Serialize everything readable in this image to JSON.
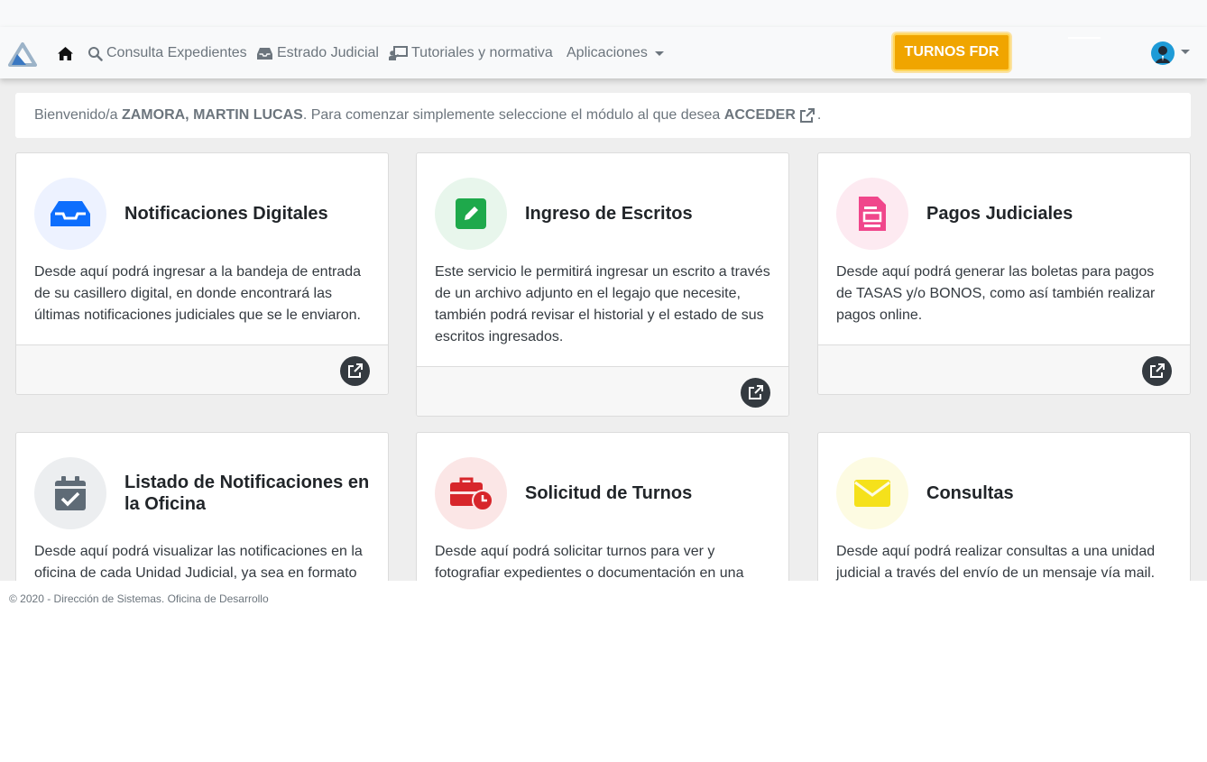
{
  "navbar": {
    "links": [
      "Consulta Expedientes",
      "Estrado Judicial",
      "Tutoriales y normativa",
      "Aplicaciones"
    ],
    "turnos_label": "TURNOS FDR"
  },
  "welcome": {
    "prefix": "Bienvenido/a",
    "user": "ZAMORA, MARTIN LUCAS",
    "middle": ". Para comenzar simplemente seleccione el módulo al que desea",
    "action": "ACCEDER",
    "end": "."
  },
  "cards": [
    {
      "title": "Notificaciones Digitales",
      "description": "Desde aquí podrá ingresar a la bandeja de entrada de su casillero digital, en donde encontrará las últimas notificaciones judiciales que se le enviaron.",
      "icon": "inbox-icon",
      "color": "#0d6efd",
      "bg": "#edf2ff"
    },
    {
      "title": "Ingreso de Escritos",
      "description": "Este servicio le permitirá ingresar un escrito a través de un archivo adjunto en el legajo que necesite, también podrá revisar el historial y el estado de sus escritos ingresados.",
      "icon": "edit-icon",
      "color": "#1ea94b",
      "bg": "#e8f6ec"
    },
    {
      "title": "Pagos Judiciales",
      "description": "Desde aquí podrá generar las boletas para pagos de TASAS y/o BONOS, como así también realizar pagos online.",
      "icon": "document-icon",
      "color": "#f0468b",
      "bg": "#fdeaf1"
    },
    {
      "title": "Listado de Notificaciones en la Oficina",
      "description": "Desde aquí podrá visualizar las notificaciones en la oficina de cada Unidad Judicial, ya sea en formato",
      "icon": "calendar-check-icon",
      "color": "#5f6b76",
      "bg": "#eceef0"
    },
    {
      "title": "Solicitud de Turnos",
      "description": "Desde aquí podrá solicitar turnos para ver y fotografiar expedientes o documentación en una",
      "icon": "briefcase-clock-icon",
      "color": "#d7262b",
      "bg": "#fbe6e6"
    },
    {
      "title": "Consultas",
      "description": "Desde aquí podrá realizar consultas a una unidad judicial a través del envío de un mensaje vía mail.",
      "icon": "envelope-icon",
      "color": "#f5e11b",
      "bg": "#fdfbe2"
    }
  ],
  "footer": {
    "copyright": "© 2020 - Dirección de Sistemas. Oficina de Desarrollo"
  }
}
